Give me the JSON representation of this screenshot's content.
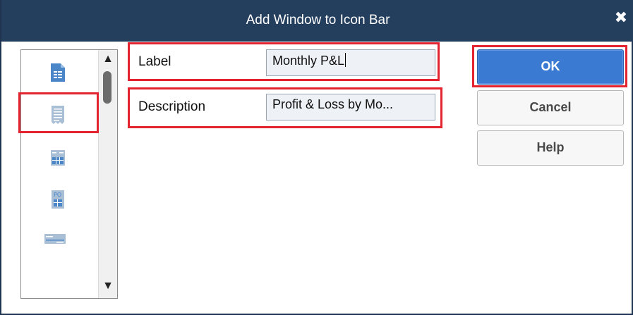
{
  "window": {
    "title": "Add Window to Icon Bar",
    "close_glyph": "✖"
  },
  "form": {
    "label_caption": "Label",
    "label_value": "Monthly P&L",
    "description_caption": "Description",
    "description_value": "Profit & Loss by Mo..."
  },
  "buttons": {
    "ok": "OK",
    "cancel": "Cancel",
    "help": "Help"
  },
  "icon_list": {
    "items": [
      "report-document-icon",
      "memorized-report-icon",
      "calendar-grid-icon",
      "purchase-order-icon",
      "check-icon"
    ],
    "selected_index": 1,
    "scroll_up_glyph": "▲",
    "scroll_down_glyph": "▼"
  },
  "colors": {
    "titlebar": "#243e5e",
    "highlight": "#e3232f",
    "primary_button": "#3a7ad2",
    "icon_blue": "#4a86c8"
  }
}
